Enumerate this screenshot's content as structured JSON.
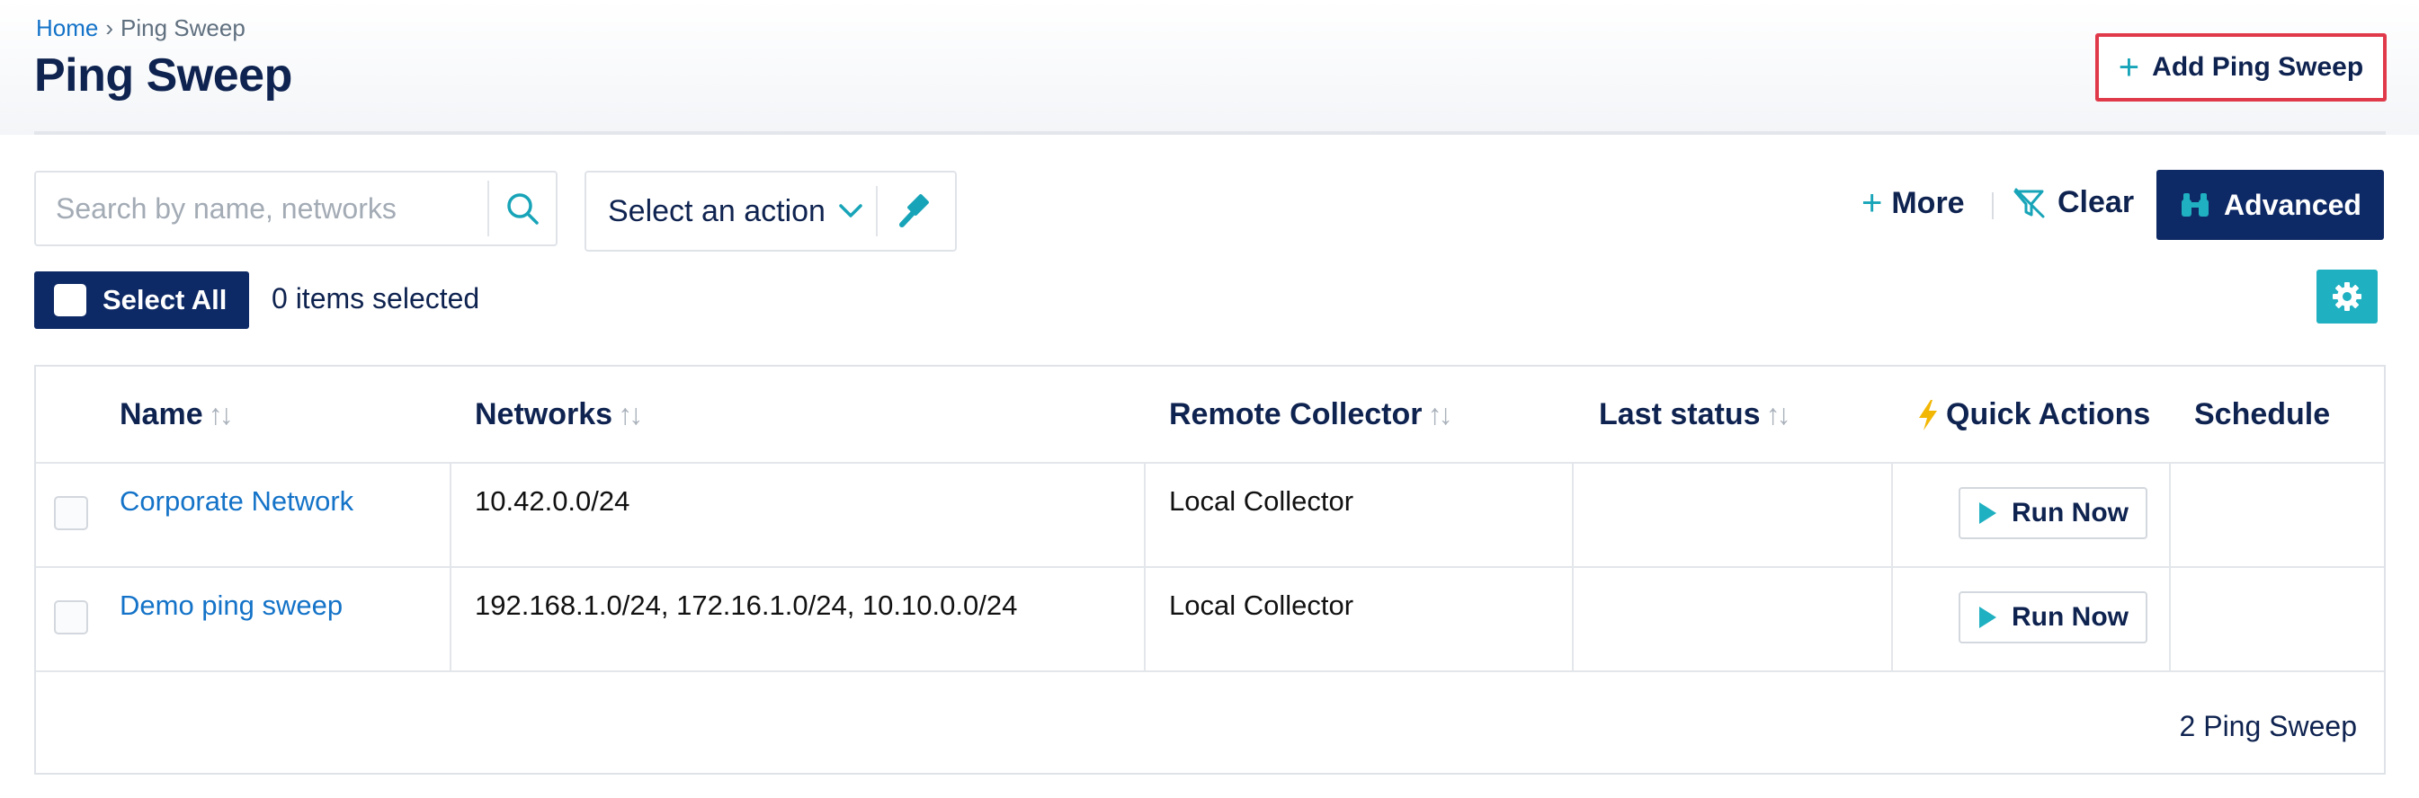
{
  "breadcrumb": {
    "home": "Home",
    "separator": "›",
    "current": "Ping Sweep"
  },
  "page": {
    "title": "Ping Sweep"
  },
  "header": {
    "add_label": "Add Ping Sweep"
  },
  "search": {
    "placeholder": "Search by name, networks",
    "value": ""
  },
  "action_select": {
    "label": "Select an action"
  },
  "filters": {
    "more_label": "More",
    "clear_label": "Clear",
    "advanced_label": "Advanced"
  },
  "selection": {
    "select_all_label": "Select All",
    "count_text": "0 items selected"
  },
  "table": {
    "columns": [
      "Name",
      "Networks",
      "Remote Collector",
      "Last status",
      "Quick Actions",
      "Schedule"
    ],
    "rows": [
      {
        "name": "Corporate Network",
        "networks": "10.42.0.0/24",
        "collector": "Local Collector",
        "last_status": "",
        "action": "Run Now",
        "schedule": ""
      },
      {
        "name": "Demo ping sweep",
        "networks": "192.168.1.0/24, 172.16.1.0/24, 10.10.0.0/24",
        "collector": "Local Collector",
        "last_status": "",
        "action": "Run Now",
        "schedule": ""
      }
    ],
    "footer": "2 Ping Sweep"
  },
  "icons": {
    "search": "search-icon",
    "chevron": "chevron-down-icon",
    "gavel": "gavel-icon",
    "plus": "plus-icon",
    "clear": "filter-clear-icon",
    "binoculars": "binoculars-icon",
    "gear": "gear-icon",
    "bolt": "lightning-icon",
    "play": "play-icon",
    "sort": "sort-icon"
  },
  "colors": {
    "navy": "#0e2a66",
    "teal": "#1fb0c1",
    "link": "#1473c8",
    "highlight_border": "#e03a4a"
  }
}
